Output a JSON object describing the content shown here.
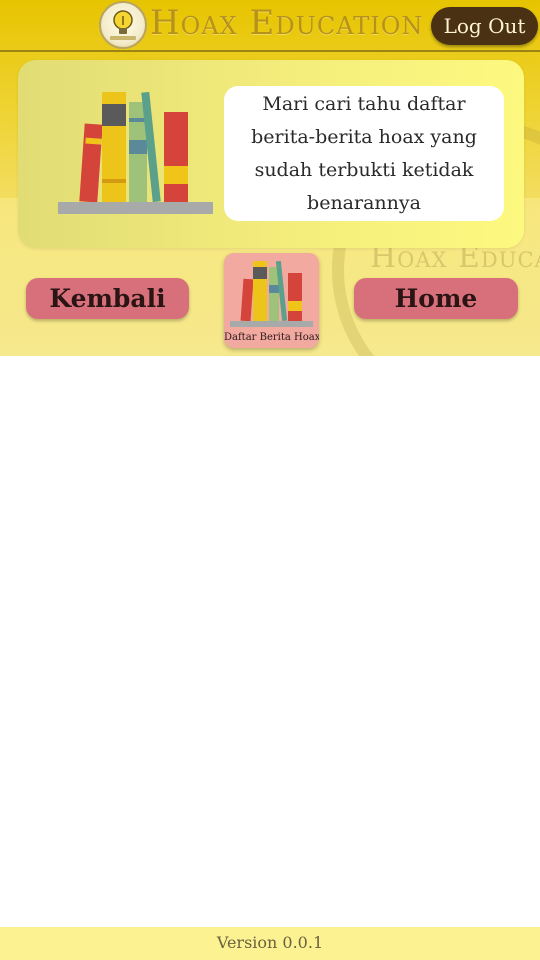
{
  "header": {
    "app_title": "Hoax Education",
    "logout_label": "Log Out",
    "logo_icon": "lightbulb-logo-icon"
  },
  "intro_card": {
    "illustration_icon": "bookshelf-icon",
    "text": "Mari cari tahu daftar berita-berita hoax yang sudah terbukti ketidak benarannya"
  },
  "nav": {
    "back_label": "Kembali",
    "home_label": "Home",
    "current_tile": {
      "label": "Daftar Berita Hoax",
      "icon": "bookshelf-icon"
    }
  },
  "footer": {
    "version": "Version 0.0.1"
  },
  "colors": {
    "header_gold": "#e7c400",
    "title_text": "#b7921b",
    "logout_bg": "#4a3114",
    "card_bg": "#f3ec7c",
    "nav_button": "#d7707a",
    "tile_bg": "#f2a9a0",
    "footer_bg": "#fdf292"
  }
}
